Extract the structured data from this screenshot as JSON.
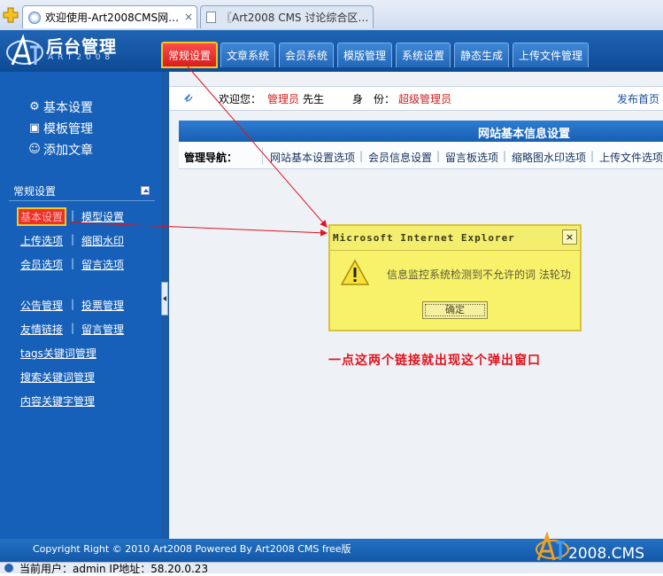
{
  "browser": {
    "tabs": [
      {
        "label": "欢迎使用-Art2008CMS网…",
        "close": "×"
      },
      {
        "label": "〖Art2008 CMS 讨论综合区…"
      }
    ]
  },
  "header": {
    "logo_title": "后台管理",
    "logo_sub": "ART2008",
    "nav": [
      "常规设置",
      "文章系统",
      "会员系统",
      "模版管理",
      "系统设置",
      "静态生成",
      "上传文件管理"
    ]
  },
  "sidebar": {
    "top_links": [
      "基本设置",
      "模板管理",
      "添加文章"
    ],
    "section_title": "常规设置",
    "link_rows": [
      [
        "基本设置",
        "模型设置"
      ],
      [
        "上传选项",
        "缩图水印"
      ],
      [
        "会员选项",
        "留言选项"
      ],
      [
        "公告管理",
        "投票管理"
      ],
      [
        "友情链接",
        "留言管理"
      ]
    ],
    "single_links": [
      "tags关键词管理",
      "搜索关键词管理",
      "内容关键字管理"
    ],
    "separator": "|"
  },
  "topbar": {
    "welcome_label": "欢迎您：",
    "user": "管理员",
    "suffix": "先生",
    "role_label": "身　份：",
    "role": "超级管理员",
    "home_link": "发布首页"
  },
  "panel": {
    "title": "网站基本信息设置",
    "subnav_label": "管理导航：",
    "subnav_links": [
      "网站基本设置选项",
      "会员信息设置",
      "留言板选项",
      "缩略图水印选项",
      "上传文件选项"
    ]
  },
  "dialog": {
    "title": "Microsoft Internet Explorer",
    "close": "×",
    "message": "信息监控系统检测到不允许的词 法轮功",
    "ok": "确定"
  },
  "annotation": "一点这两个链接就出现这个弹出窗口",
  "footer": {
    "copyright": "Copyright Right © 2010 Art2008 Powered By Art2008 CMS free版",
    "logo_text": "2008.CMS",
    "logo_letters": "ART"
  },
  "statusbar": {
    "text": "当前用户：admin  IP地址：58.20.0.23"
  },
  "colors": {
    "brand_blue": "#1660b9",
    "active_red": "#e9302a",
    "highlight_yellow": "#f4c81c",
    "dialog_yellow": "#f8f26a",
    "annotation_red": "#e3131d"
  }
}
